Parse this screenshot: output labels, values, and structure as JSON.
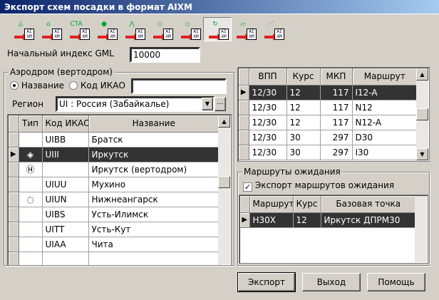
{
  "window": {
    "title": "Экспорт схем посадки в формат AIXM"
  },
  "toolbar": {
    "aixm_label": "AI XM",
    "buttons": [
      {
        "name": "export-aerodrome-button",
        "glyph": "◬"
      },
      {
        "name": "export-airspace-button",
        "glyph": "⌂"
      },
      {
        "name": "export-cta-button",
        "glyph": "CTA"
      },
      {
        "name": "export-restricted-area-button",
        "glyph": "●"
      },
      {
        "name": "export-navaid-button",
        "glyph": "⋀"
      },
      {
        "name": "export-sid-button",
        "glyph": "◇"
      },
      {
        "name": "export-star-button",
        "glyph": "◇"
      },
      {
        "name": "export-approach-button",
        "glyph": "↻",
        "pressed": true
      },
      {
        "name": "export-runway-button",
        "glyph": "▱"
      },
      {
        "name": "export-obstacle-button",
        "glyph": "⋰"
      }
    ]
  },
  "gml": {
    "label": "Начальный индекс GML",
    "value": "10000"
  },
  "aerodrome": {
    "group_label": "Аэродром (вертодром)",
    "radio_name": "Название",
    "radio_icao": "Код ИКАО",
    "search_value": "",
    "region_label": "Регион",
    "region_value": "UI : Россия (Забайкалье)",
    "ellipsis": "...",
    "columns": [
      "Тип",
      "Код ИКАО",
      "Название"
    ],
    "rows": [
      {
        "type": "",
        "icao": "UIBB",
        "name": "Братск"
      },
      {
        "type": "◈",
        "icao": "UIII",
        "name": "Иркутск",
        "selected": true
      },
      {
        "type": "Ⓗ",
        "icao": "",
        "name": "Иркутск (вертодром)"
      },
      {
        "type": "",
        "icao": "UIUU",
        "name": "Мухино"
      },
      {
        "type": "◌",
        "icao": "UIUN",
        "name": "Нижнеангарск"
      },
      {
        "type": "",
        "icao": "UIBS",
        "name": "Усть-Илимск"
      },
      {
        "type": "",
        "icao": "UITT",
        "name": "Усть-Кут"
      },
      {
        "type": "",
        "icao": "UIAA",
        "name": "Чита"
      }
    ]
  },
  "procedures": {
    "columns": [
      "ВПП",
      "Курс",
      "МКП",
      "Маршрут"
    ],
    "rows": [
      {
        "rwy": "12/30",
        "course": "12",
        "mag": "117",
        "route": "I12-A",
        "selected": true
      },
      {
        "rwy": "12/30",
        "course": "12",
        "mag": "117",
        "route": "N12"
      },
      {
        "rwy": "12/30",
        "course": "12",
        "mag": "117",
        "route": "N12-A"
      },
      {
        "rwy": "12/30",
        "course": "30",
        "mag": "297",
        "route": "D30"
      },
      {
        "rwy": "12/30",
        "course": "30",
        "mag": "297",
        "route": "I30"
      }
    ]
  },
  "holding": {
    "group_label": "Маршруты ожидания",
    "checkbox_label": "Экспорт маршрутов ожидания",
    "checked": true,
    "columns": [
      "Маршрут",
      "Курс",
      "Базовая точка"
    ],
    "rows": [
      {
        "route": "H30X",
        "course": "12",
        "point": "Иркутск ДПРМ30",
        "selected": true
      }
    ]
  },
  "buttons": {
    "export": "Экспорт",
    "exit": "Выход",
    "help": "Помощь"
  }
}
